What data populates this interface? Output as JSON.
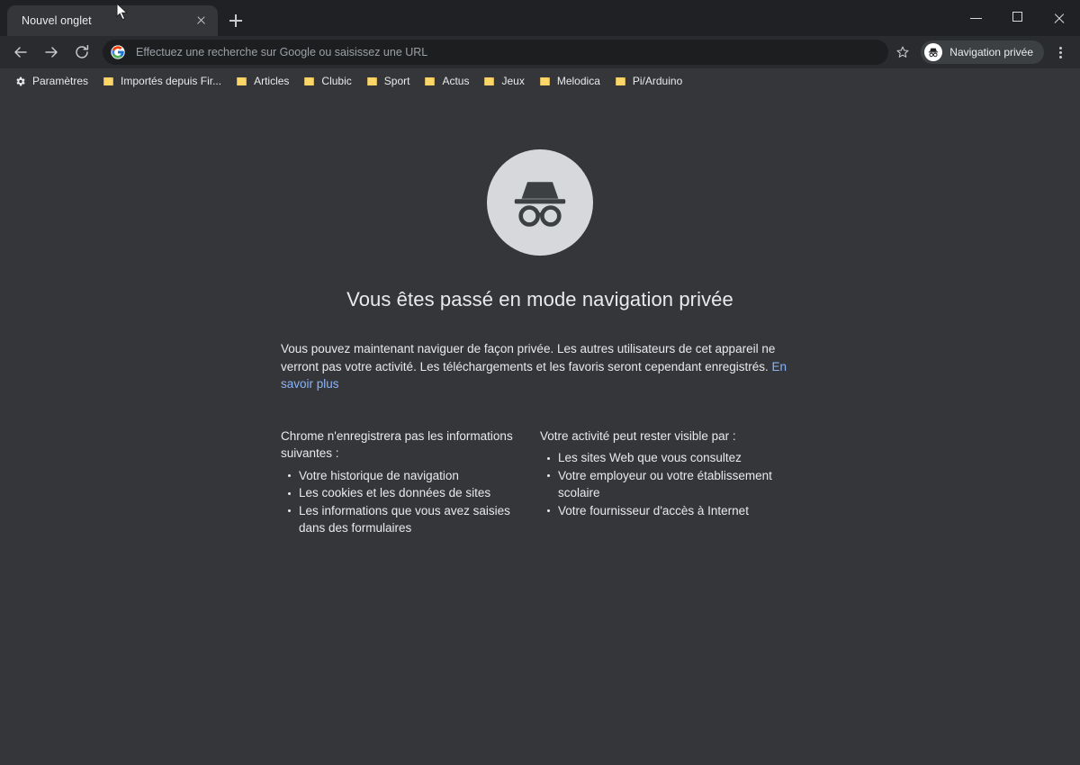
{
  "window": {
    "controls": {
      "minimize": "minimize-icon",
      "maximize": "maximize-icon",
      "close": "close-icon"
    }
  },
  "tabstrip": {
    "tabs": [
      {
        "title": "Nouvel onglet",
        "active": true
      }
    ],
    "new_tab_label": "+"
  },
  "toolbar": {
    "back_icon": "back-arrow-icon",
    "forward_icon": "forward-arrow-icon",
    "reload_icon": "reload-icon",
    "omnibox": {
      "placeholder": "Effectuez une recherche sur Google ou saisissez une URL",
      "value": "",
      "leading_icon": "google-g-icon"
    },
    "bookmark_star_icon": "star-icon",
    "incognito_pill_label": "Navigation privée",
    "incognito_pill_icon": "incognito-avatar-icon",
    "menu_icon": "three-dots-menu-icon"
  },
  "bookmarks": {
    "items": [
      {
        "label": "Paramètres",
        "icon": "gear-icon"
      },
      {
        "label": "Importés depuis Fir...",
        "icon": "folder-icon"
      },
      {
        "label": "Articles",
        "icon": "folder-icon"
      },
      {
        "label": "Clubic",
        "icon": "folder-icon"
      },
      {
        "label": "Sport",
        "icon": "folder-icon"
      },
      {
        "label": "Actus",
        "icon": "folder-icon"
      },
      {
        "label": "Jeux",
        "icon": "folder-icon"
      },
      {
        "label": "Melodica",
        "icon": "folder-icon"
      },
      {
        "label": "Pi/Arduino",
        "icon": "folder-icon"
      }
    ]
  },
  "page": {
    "hero_icon": "incognito-icon",
    "title": "Vous êtes passé en mode navigation privée",
    "intro_text": "Vous pouvez maintenant naviguer de façon privée. Les autres utilisateurs de cet appareil ne verront pas votre activité. Les téléchargements et les favoris seront cependant enregistrés. ",
    "learn_more": "En savoir plus",
    "columns": [
      {
        "heading": "Chrome n'enregistrera pas les informations suivantes :",
        "items": [
          "Votre historique de navigation",
          "Les cookies et les données de sites",
          "Les informations que vous avez saisies dans des formulaires"
        ]
      },
      {
        "heading": "Votre activité peut rester visible par :",
        "items": [
          "Les sites Web que vous consultez",
          "Votre employeur ou votre établissement scolaire",
          "Votre fournisseur d'accès à Internet"
        ]
      }
    ]
  },
  "colors": {
    "tabstrip_bg": "#202124",
    "toolbar_bg": "#292b2e",
    "bookmarks_bg": "#35363a",
    "page_bg": "#35363a",
    "omnibox_bg": "#1d1e20",
    "text_primary": "#e8eaed",
    "text_muted": "#9aa0a6",
    "link": "#8ab4f8",
    "folder_yellow": "#fcd667",
    "incognito_circle": "#d6d8dc"
  }
}
